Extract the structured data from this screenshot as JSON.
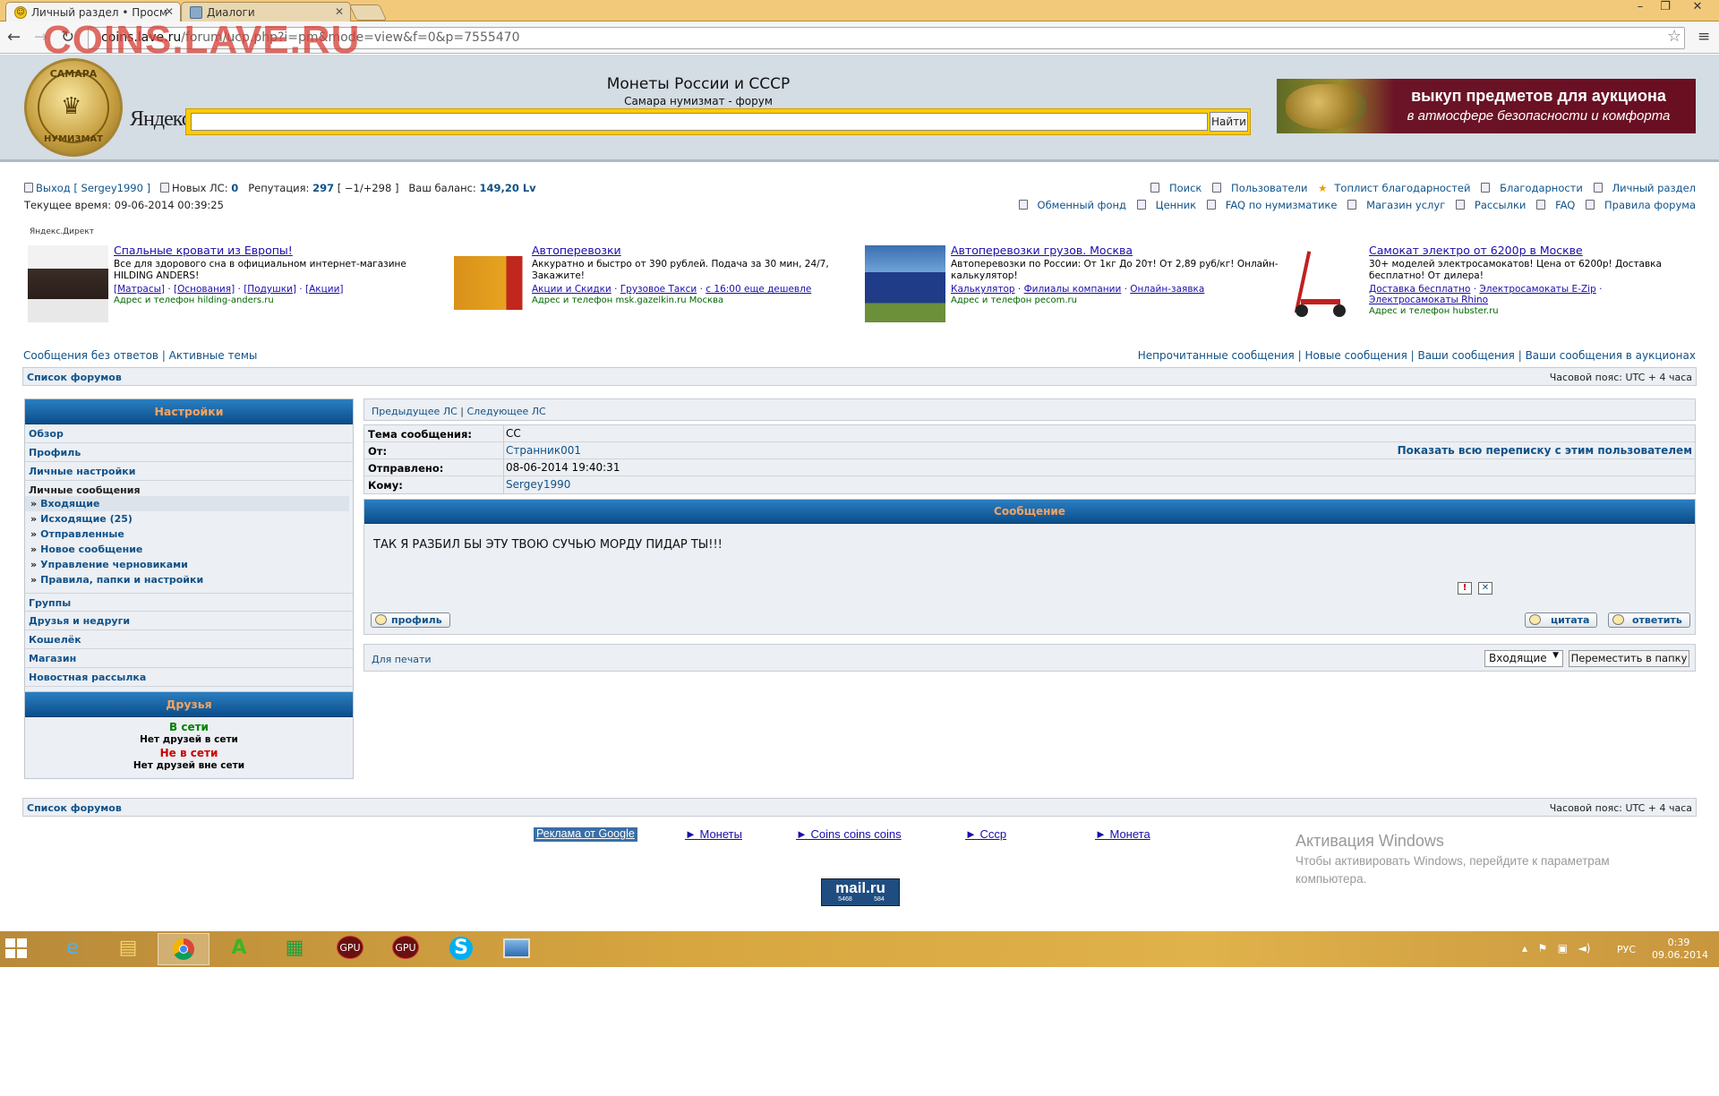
{
  "browser": {
    "tabs": [
      {
        "label": "Личный раздел • Просм"
      },
      {
        "label": "Диалоги"
      }
    ],
    "url_host": "coins.lave.ru",
    "url_path": "/forum/ucp.php?i=pm&mode=view&f=0&p=7555470",
    "watermark": "COINS.LAVE.RU"
  },
  "site": {
    "title": "Монеты России и СССР",
    "subtitle": "Самара нумизмат - форум",
    "logo_top": "САМАРА",
    "logo_bottom": "НУМИЗМАТ",
    "yandex_label": "Яндекс",
    "search_button": "Найти",
    "banner_line1": "выкуп предметов для аукциона",
    "banner_line2": "в атмосфере безопасности и комфорта"
  },
  "userbar": {
    "logout": "Выход [ Sergey1990 ]",
    "new_pm_label": "Новых ЛС:",
    "new_pm": "0",
    "rep_label": "Репутация:",
    "rep": "297",
    "rep_detail": "[ −1/+298 ]",
    "balance_label": "Ваш баланс:",
    "balance": "149,20 Lv",
    "time": "Текущее время: 09-06-2014 00:39:25",
    "links_row1": [
      "Поиск",
      "Пользователи",
      "Топлист благодарностей",
      "Благодарности",
      "Личный раздел"
    ],
    "links_row2": [
      "Обменный фонд",
      "Ценник",
      "FAQ по нумизматике",
      "Магазин услуг",
      "Рассылки",
      "FAQ",
      "Правила форума"
    ]
  },
  "ads": {
    "label": "Яндекс.Директ",
    "items": [
      {
        "title": "Спальные кровати из Европы!",
        "desc": "Все для здорового сна в официальном интернет-магазине HILDING ANDERS!",
        "links": [
          "Матрасы",
          "Основания",
          "Подушки",
          "Акции"
        ],
        "addr": "Адрес и телефон hilding-anders.ru"
      },
      {
        "title": "Автоперевозки",
        "desc": "Аккуратно и быстро от 390 рублей. Подача за 30 мин, 24/7, Закажите!",
        "links": [
          "Акции и Скидки",
          "Грузовое Такси",
          "с 16:00 еще дешевле"
        ],
        "addr": "Адрес и телефон msk.gazelkin.ru Москва"
      },
      {
        "title": "Автоперевозки грузов. Москва",
        "desc": "Автоперевозки по России: От 1кг До 20т! От 2,89 руб/кг! Онлайн-калькулятор!",
        "links": [
          "Калькулятор",
          "Филиалы компании",
          "Онлайн-заявка"
        ],
        "addr": "Адрес и телефон pecom.ru"
      },
      {
        "title": "Самокат электро от 6200р в Москве",
        "desc": "30+ моделей электросамокатов! Цена от 6200р! Доставка бесплатно! От дилера!",
        "links": [
          "Доставка бесплатно",
          "Электросамокаты E-Zip",
          "Электросамокаты Rhino"
        ],
        "addr": "Адрес и телефон hubster.ru"
      }
    ]
  },
  "forumnav": {
    "left": [
      "Сообщения без ответов",
      "Активные темы"
    ],
    "right": [
      "Непрочитанные сообщения",
      "Новые сообщения",
      "Ваши сообщения",
      "Ваши сообщения в аукционах"
    ],
    "forum_list": "Список форумов",
    "timezone": "Часовой пояс: UTC + 4 часа"
  },
  "settings": {
    "title": "Настройки",
    "items_top": [
      "Обзор",
      "Профиль",
      "Личные настройки"
    ],
    "pm_section": "Личные сообщения",
    "pm_items": [
      "Входящие",
      "Исходящие (25)",
      "Отправленные",
      "Новое сообщение",
      "Управление черновиками",
      "Правила, папки и настройки"
    ],
    "items_bottom": [
      "Группы",
      "Друзья и недруги",
      "Кошелёк",
      "Магазин",
      "Новостная рассылка"
    ]
  },
  "friends": {
    "title": "Друзья",
    "online": "В сети",
    "online_none": "Нет друзей в сети",
    "offline": "Не в сети",
    "offline_none": "Нет друзей вне сети",
    "online_color": "#008000",
    "offline_color": "#cc0000"
  },
  "message": {
    "prev": "Предыдущее ЛС",
    "next": "Следующее ЛС",
    "subject_label": "Тема сообщения:",
    "subject": "СС",
    "from_label": "От:",
    "from": "Странник001",
    "show_all": "Показать всю переписку с этим пользователем",
    "sent_label": "Отправлено:",
    "sent": "08-06-2014 19:40:31",
    "to_label": "Кому:",
    "to": "Sergey1990",
    "section_title": "Сообщение",
    "body": "ТАК Я РАЗБИЛ БЫ ЭТУ ТВОЮ СУЧЬЮ МОРДУ ПИДАР ТЫ!!!",
    "btn_profile": "профиль",
    "btn_quote": "цитата",
    "btn_reply": "ответить",
    "print": "Для печати",
    "folder": "Входящие",
    "move": "Переместить в папку"
  },
  "footer": {
    "google_label": "Реклама от Google",
    "google_links": [
      "► Монеты",
      "► Coins coins coins",
      "► Ссср",
      "► Монета"
    ],
    "mailru": "mail.ru",
    "mailru_n1": "5468",
    "mailru_n2": "584",
    "activation_title": "Активация Windows",
    "activation_text": "Чтобы активировать Windows, перейдите к параметрам компьютера."
  },
  "taskbar": {
    "lang": "РУС",
    "time": "0:39",
    "date": "09.06.2014"
  },
  "colors": {
    "panel_head": "#0b4e8b",
    "panel_head_text": "#f9a35f",
    "link": "#105289",
    "search_frame": "#ffcc00"
  }
}
